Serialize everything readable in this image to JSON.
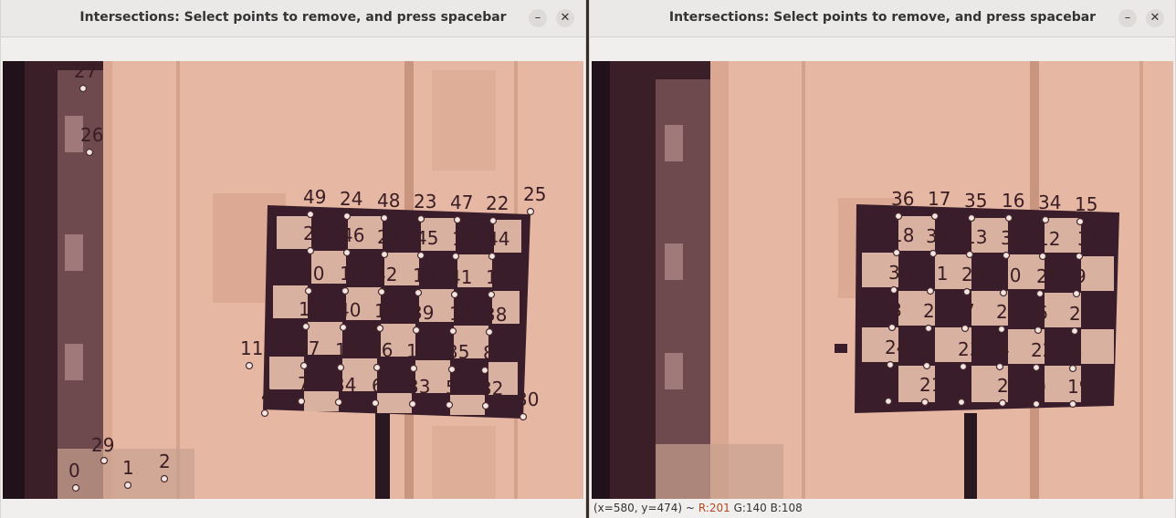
{
  "left_window": {
    "title": "Intersections: Select points to remove, and press spacebar",
    "minimize_glyph": "–",
    "close_glyph": "✕",
    "points": [
      {
        "label": "27"
      },
      {
        "label": "26"
      },
      {
        "label": "49"
      },
      {
        "label": "24"
      },
      {
        "label": "48"
      },
      {
        "label": "23"
      },
      {
        "label": "47"
      },
      {
        "label": "22"
      },
      {
        "label": "25"
      },
      {
        "label": "28"
      },
      {
        "label": "46"
      },
      {
        "label": "21"
      },
      {
        "label": "45"
      },
      {
        "label": "19"
      },
      {
        "label": "44"
      },
      {
        "label": "50"
      },
      {
        "label": "18"
      },
      {
        "label": "42"
      },
      {
        "label": "17"
      },
      {
        "label": "41"
      },
      {
        "label": "16"
      },
      {
        "label": "15"
      },
      {
        "label": "40"
      },
      {
        "label": "14"
      },
      {
        "label": "39"
      },
      {
        "label": "13"
      },
      {
        "label": "38"
      },
      {
        "label": "11"
      },
      {
        "label": "37"
      },
      {
        "label": "12"
      },
      {
        "label": "36"
      },
      {
        "label": "10"
      },
      {
        "label": "35"
      },
      {
        "label": "8"
      },
      {
        "label": "7"
      },
      {
        "label": "34"
      },
      {
        "label": "6"
      },
      {
        "label": "33"
      },
      {
        "label": "5"
      },
      {
        "label": "32"
      },
      {
        "label": "30"
      },
      {
        "label": "4"
      },
      {
        "label": "29"
      },
      {
        "label": "2"
      },
      {
        "label": "0"
      },
      {
        "label": "1"
      }
    ]
  },
  "right_window": {
    "title": "Intersections: Select points to remove, and press spacebar",
    "minimize_glyph": "–",
    "close_glyph": "✕",
    "points": [
      {
        "label": "36"
      },
      {
        "label": "17"
      },
      {
        "label": "35"
      },
      {
        "label": "16"
      },
      {
        "label": "34"
      },
      {
        "label": "15"
      },
      {
        "label": "18"
      },
      {
        "label": "33"
      },
      {
        "label": "13"
      },
      {
        "label": "32"
      },
      {
        "label": "12"
      },
      {
        "label": "31"
      },
      {
        "label": "30"
      },
      {
        "label": "11"
      },
      {
        "label": "29"
      },
      {
        "label": "10"
      },
      {
        "label": "28"
      },
      {
        "label": "9"
      },
      {
        "label": "8"
      },
      {
        "label": "27"
      },
      {
        "label": "7"
      },
      {
        "label": "26"
      },
      {
        "label": "6"
      },
      {
        "label": "25"
      },
      {
        "label": "24"
      },
      {
        "label": "5"
      },
      {
        "label": "23"
      },
      {
        "label": "4"
      },
      {
        "label": "22"
      },
      {
        "label": "3"
      },
      {
        "label": "2"
      },
      {
        "label": "21"
      },
      {
        "label": "1"
      },
      {
        "label": "20"
      },
      {
        "label": "0"
      },
      {
        "label": "19"
      }
    ],
    "status": {
      "coords": "(x=580, y=474) ~",
      "r": "R:201",
      "g": "G:140",
      "b": "B:108"
    }
  }
}
